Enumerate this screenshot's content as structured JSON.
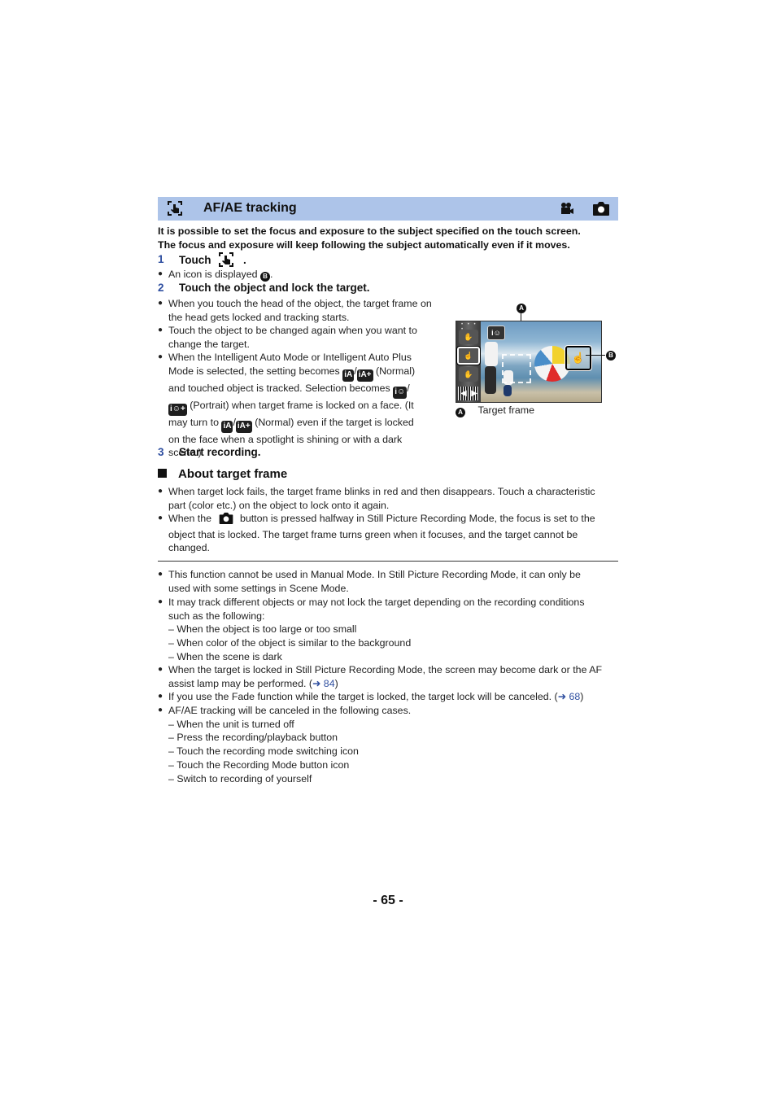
{
  "header": {
    "title": "AF/AE tracking",
    "left_icon": "touch-tracking-icon",
    "right_icons": [
      "motion-picture-icon",
      "camera-icon"
    ],
    "bar_color": "#adc4e9"
  },
  "intro": [
    "It is possible to set the focus and exposure to the subject specified on the touch screen.",
    "The focus and exposure will keep following the subject automatically even if it moves."
  ],
  "steps": [
    {
      "num": "1",
      "text": "Touch",
      "after_icon": "."
    },
    {
      "num": "2",
      "text": "Touch the object and lock the target."
    },
    {
      "num": "3",
      "text": "Start recording."
    }
  ],
  "step1_note": {
    "text": "An icon is displayed",
    "marker": "B",
    "end": "."
  },
  "step2_bullets": {
    "b1": [
      "When you touch the head of the object, the target frame on",
      "the head gets locked and tracking starts."
    ],
    "b2": [
      "Touch the object to be changed again when you want to",
      "change the target."
    ],
    "b3": {
      "l1": "When the Intelligent Auto Mode or Intelligent Auto Plus",
      "l2a": "Mode is selected, the setting becomes",
      "l2b": "(Normal)",
      "l3": "and touched object is tracked. Selection becomes",
      "l4": "(Portrait) when target frame is locked on a face. (It",
      "l5a": "may turn to",
      "l5b": "(Normal) even if the target is locked",
      "l6": "on the face when a spotlight is shining or with a dark",
      "l7": "scene.)"
    }
  },
  "mode_icons": {
    "ia": "iA",
    "ia_plus": "iA+",
    "portrait": "i☺",
    "portrait_plus": "i☺+",
    "slash": "/"
  },
  "illustration": {
    "callout_a": "A",
    "callout_b": "B",
    "caption_marker": "A",
    "caption": "Target frame",
    "side_dots": "• • • •"
  },
  "about": {
    "title": "About target frame",
    "b1": [
      "When target lock fails, the target frame blinks in red and then disappears. Touch a characteristic",
      "part (color etc.) on the object to lock onto it again."
    ],
    "b2": {
      "l1a": "When the",
      "l1b": "button is pressed halfway in Still Picture Recording Mode, the focus is set to the",
      "l2": "object that is locked. The target frame turns green when it focuses, and the target cannot be",
      "l3": "changed."
    }
  },
  "notes": {
    "n1": [
      "This function cannot be used in Manual Mode. In Still Picture Recording Mode, it can only be",
      "used with some settings in Scene Mode."
    ],
    "n2": [
      "It may track different objects or may not lock the target depending on the recording conditions",
      "such as the following:"
    ],
    "n2_subs": [
      "– When the object is too large or too small",
      "– When color of the object is similar to the background",
      "– When the scene is dark"
    ],
    "n3": {
      "l1": "When the target is locked in Still Picture Recording Mode, the screen may become dark or the AF",
      "l2": "assist lamp may be performed. (",
      "ref": "➜ 84",
      "end": ")"
    },
    "n4": {
      "l1": "If you use the Fade function while the target is locked, the target lock will be canceled. (",
      "ref": "➜ 68",
      "end": ")"
    },
    "n5": "AF/AE tracking will be canceled in the following cases.",
    "n5_subs": [
      "– When the unit is turned off",
      "– Press the recording/playback button",
      "– Touch the recording mode switching icon",
      "– Touch the Recording Mode button icon",
      "– Switch to recording of yourself"
    ]
  },
  "page_number": "- 65 -",
  "bullet": "●"
}
